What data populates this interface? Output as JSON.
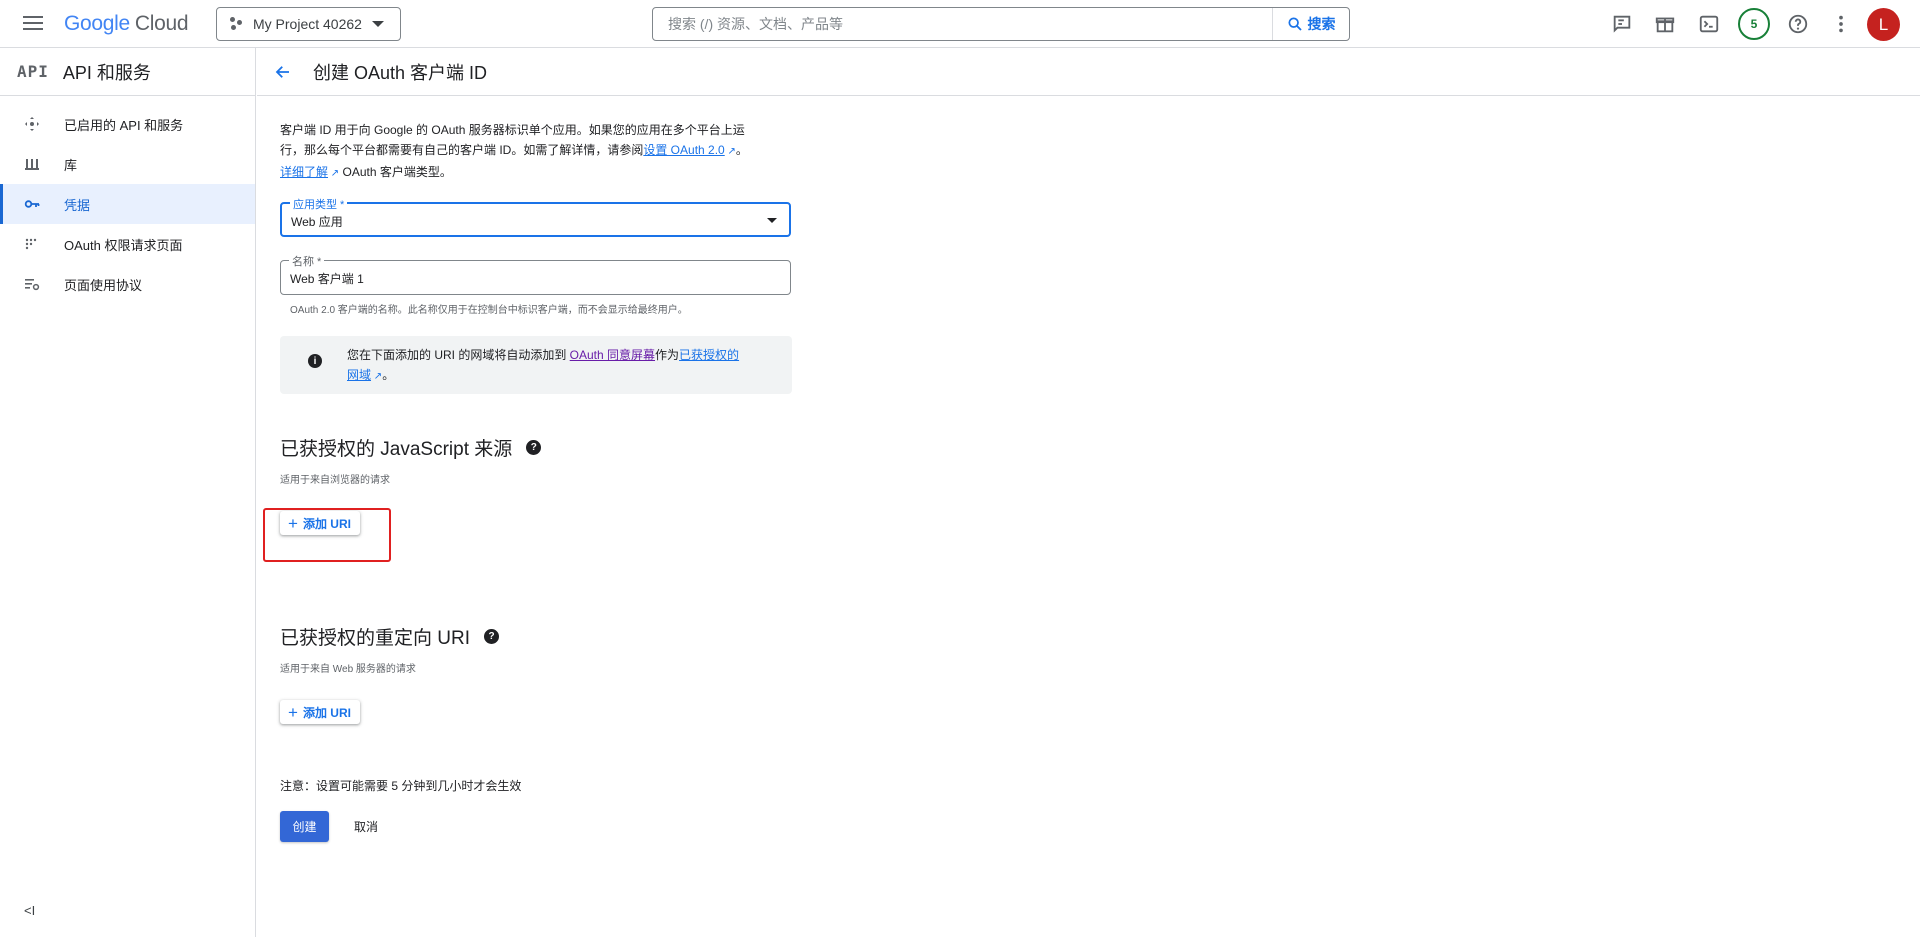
{
  "header": {
    "logo_google": "Google",
    "logo_cloud": "Cloud",
    "project_name": "My Project 40262",
    "search_placeholder": "搜索 (/) 资源、文档、产品等",
    "search_button": "搜索",
    "notification_count": "5",
    "avatar_letter": "L"
  },
  "sidebar": {
    "logo": "API",
    "title": "API 和服务",
    "items": [
      {
        "label": "已启用的 API 和服务",
        "icon": "api-hub-icon"
      },
      {
        "label": "库",
        "icon": "library-icon"
      },
      {
        "label": "凭据",
        "icon": "key-icon"
      },
      {
        "label": "OAuth 权限请求页面",
        "icon": "consent-icon"
      },
      {
        "label": "页面使用协议",
        "icon": "settings-list-icon"
      }
    ],
    "active_index": 2,
    "collapse": "<I"
  },
  "page": {
    "title": "创建 OAuth 客户端 ID",
    "desc_line1": "客户端 ID 用于向 Google 的 OAuth 服务器标识单个应用。如果您的应用在多个平台上运",
    "desc_line2": "行，那么每个平台都需要有自己的客户端 ID。如需了解详情，请参阅",
    "desc_link1": "设置 OAuth 2.0",
    "desc_end1": "。",
    "desc_link2": "详细了解",
    "desc_end2": " OAuth 客户端类型。",
    "app_type_label": "应用类型 *",
    "app_type_value": "Web 应用",
    "name_label": "名称 *",
    "name_value": "Web 客户端 1",
    "name_hint": "OAuth 2.0 客户端的名称。此名称仅用于在控制台中标识客户端，而不会显示给最终用户。",
    "info_text1": "您在下面添加的 URI 的网域将自动添加到 ",
    "info_link1": "OAuth 同意屏幕",
    "info_text2": "作为",
    "info_link2": "已获授权的",
    "info_link3": "网域",
    "info_end": "。",
    "js_title": "已获授权的 JavaScript 来源",
    "js_sub": "适用于来自浏览器的请求",
    "add_uri": "添加 URI",
    "redirect_title": "已获授权的重定向 URI",
    "redirect_sub": "适用于来自 Web 服务器的请求",
    "note": "注意：设置可能需要 5 分钟到几小时才会生效",
    "create": "创建",
    "cancel": "取消"
  }
}
